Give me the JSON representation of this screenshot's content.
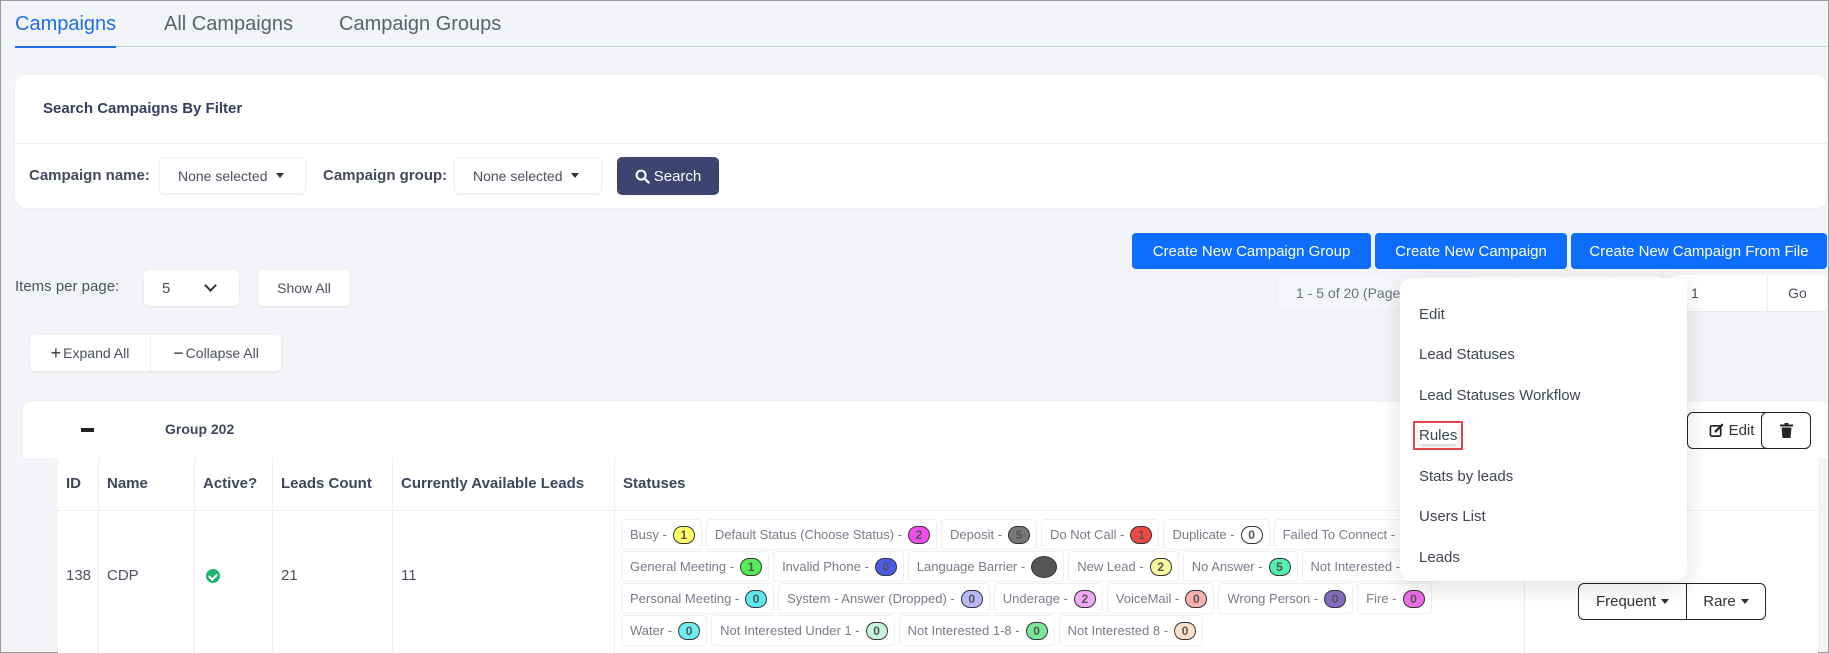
{
  "tabs": [
    {
      "label": "Campaigns",
      "active": true
    },
    {
      "label": "All Campaigns",
      "active": false
    },
    {
      "label": "Campaign Groups",
      "active": false
    }
  ],
  "filter": {
    "title": "Search Campaigns By Filter",
    "campaign_name_label": "Campaign name:",
    "campaign_name_value": "None selected",
    "campaign_group_label": "Campaign group:",
    "campaign_group_value": "None selected",
    "search_label": "Search"
  },
  "actions": {
    "create_group": "Create New Campaign Group",
    "create_campaign": "Create New Campaign",
    "create_from_file": "Create New Campaign From File"
  },
  "paging": {
    "items_per_page_label": "Items per page:",
    "items_per_page_value": "5",
    "show_all": "Show All",
    "info": "1 - 5 of 20 (Page",
    "page_input": "1",
    "go": "Go"
  },
  "expand_all": "Expand All",
  "collapse_all": "Collapse All",
  "group": {
    "name": "Group 202",
    "edit_label": "Edit"
  },
  "table": {
    "headers": [
      "ID",
      "Name",
      "Active?",
      "Leads Count",
      "Currently Available Leads",
      "Statuses"
    ],
    "row": {
      "id": "138",
      "name": "CDP",
      "active": true,
      "leads_count": "21",
      "available_leads": "11",
      "status_rows": [
        [
          {
            "label": "Busy -",
            "count": "1",
            "color": "#ffff66"
          },
          {
            "label": "Default Status (Choose Status) -",
            "count": "2",
            "color": "#f54cf0"
          },
          {
            "label": "Deposit -",
            "count": "5",
            "color": "#777777"
          },
          {
            "label": "Do Not Call -",
            "count": "1",
            "color": "#f04747"
          },
          {
            "label": "Duplicate -",
            "count": "0",
            "color": "#ffffff"
          },
          {
            "label": "Failed To Connect -",
            "count": "",
            "color": "#ffffff"
          }
        ],
        [
          {
            "label": "General Meeting -",
            "count": "1",
            "color": "#55ee55"
          },
          {
            "label": "Invalid Phone -",
            "count": "0",
            "color": "#4c5ae8"
          },
          {
            "label": "Language Barrier -",
            "count": "",
            "color": "#555555"
          },
          {
            "label": "New Lead -",
            "count": "2",
            "color": "#fafaa0"
          },
          {
            "label": "No Answer -",
            "count": "5",
            "color": "#4ff0b0"
          },
          {
            "label": "Not Interested -",
            "count": "",
            "color": "#ffffff"
          }
        ],
        [
          {
            "label": "Personal Meeting -",
            "count": "0",
            "color": "#5ce8ee"
          },
          {
            "label": "System - Answer (Dropped) -",
            "count": "0",
            "color": "#b8b8f5"
          },
          {
            "label": "Underage -",
            "count": "2",
            "color": "#f3a8f5"
          },
          {
            "label": "VoiceMail -",
            "count": "0",
            "color": "#f8b0b0"
          },
          {
            "label": "Wrong Person -",
            "count": "0",
            "color": "#7f6bbf"
          },
          {
            "label": "Fire -",
            "count": "0",
            "color": "#ee6ee8"
          }
        ],
        [
          {
            "label": "Water -",
            "count": "0",
            "color": "#6ef0f2"
          },
          {
            "label": "Not Interested Under 1 -",
            "count": "0",
            "color": "#c8f5de"
          },
          {
            "label": "Not Interested 1-8 -",
            "count": "0",
            "color": "#7ce89c"
          },
          {
            "label": "Not Interested 8 -",
            "count": "0",
            "color": "#fde0c8"
          }
        ]
      ],
      "frequent_label": "Frequent",
      "rare_label": "Rare"
    }
  },
  "menu": {
    "items": [
      "Edit",
      "Lead Statuses",
      "Lead Statuses Workflow",
      "Rules",
      "Stats by leads",
      "Users List",
      "Leads"
    ],
    "highlighted": "Rules"
  },
  "colors": {
    "primary": "#0d6efd",
    "tab_active": "#1e6fe8",
    "search_button": "#3c456f",
    "active_check": "#1fb46b",
    "highlight_box": "#e24545"
  }
}
